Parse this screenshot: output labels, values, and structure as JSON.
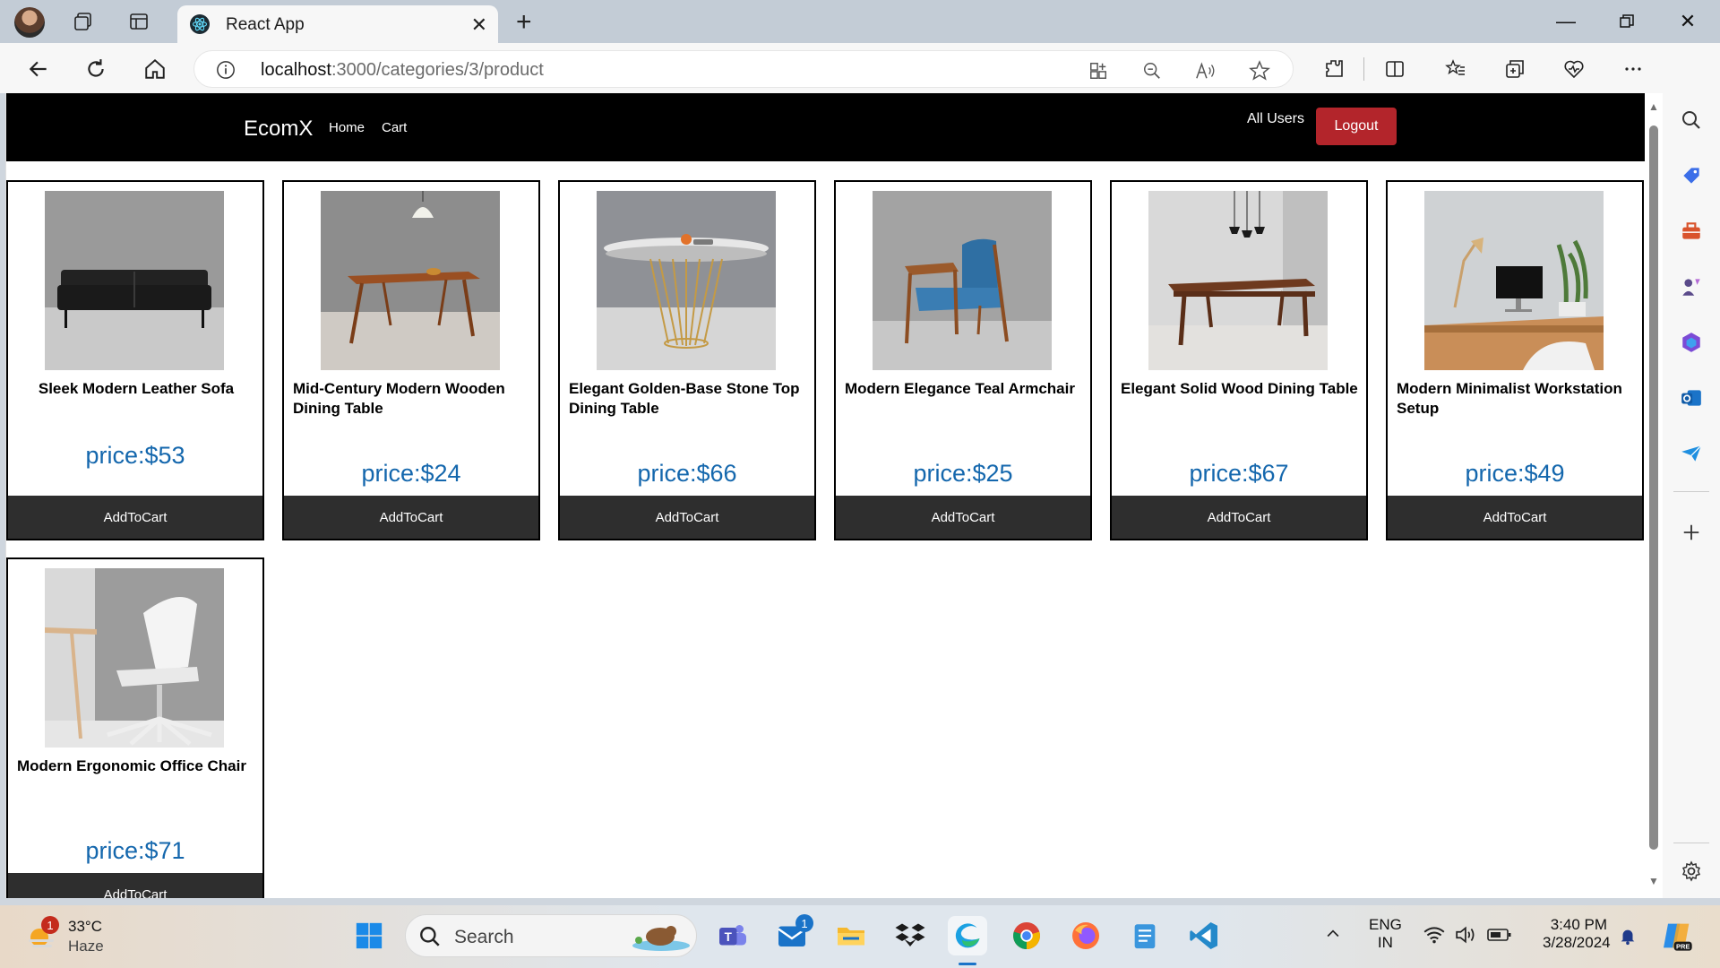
{
  "browser": {
    "tab_title": "React App",
    "url_host": "localhost",
    "url_path": ":3000/categories/3/product"
  },
  "site": {
    "brand": "EcomX",
    "nav": {
      "home": "Home",
      "cart": "Cart"
    },
    "all_users": "All Users",
    "logout": "Logout"
  },
  "products": [
    {
      "name": "Sleek Modern Leather Sofa",
      "price": "price:$53",
      "button": "AddToCart"
    },
    {
      "name": "Mid-Century Modern Wooden Dining Table",
      "price": "price:$24",
      "button": "AddToCart"
    },
    {
      "name": "Elegant Golden-Base Stone Top Dining Table",
      "price": "price:$66",
      "button": "AddToCart"
    },
    {
      "name": "Modern Elegance Teal Armchair",
      "price": "price:$25",
      "button": "AddToCart"
    },
    {
      "name": "Elegant Solid Wood Dining Table",
      "price": "price:$67",
      "button": "AddToCart"
    },
    {
      "name": "Modern Minimalist Workstation Setup",
      "price": "price:$49",
      "button": "AddToCart"
    },
    {
      "name": "Modern Ergonomic Office Chair",
      "price": "price:$71",
      "button": "AddToCart"
    }
  ],
  "taskbar": {
    "weather_temp": "33°C",
    "weather_desc": "Haze",
    "weather_badge": "1",
    "search_label": "Search",
    "mail_badge": "1",
    "lang_top": "ENG",
    "lang_bottom": "IN",
    "time": "3:40 PM",
    "date": "3/28/2024"
  },
  "colors": {
    "site_nav_bg": "#000000",
    "logout_bg": "#b3252b",
    "price_color": "#1467ad",
    "button_bg": "#2e2e2e"
  }
}
